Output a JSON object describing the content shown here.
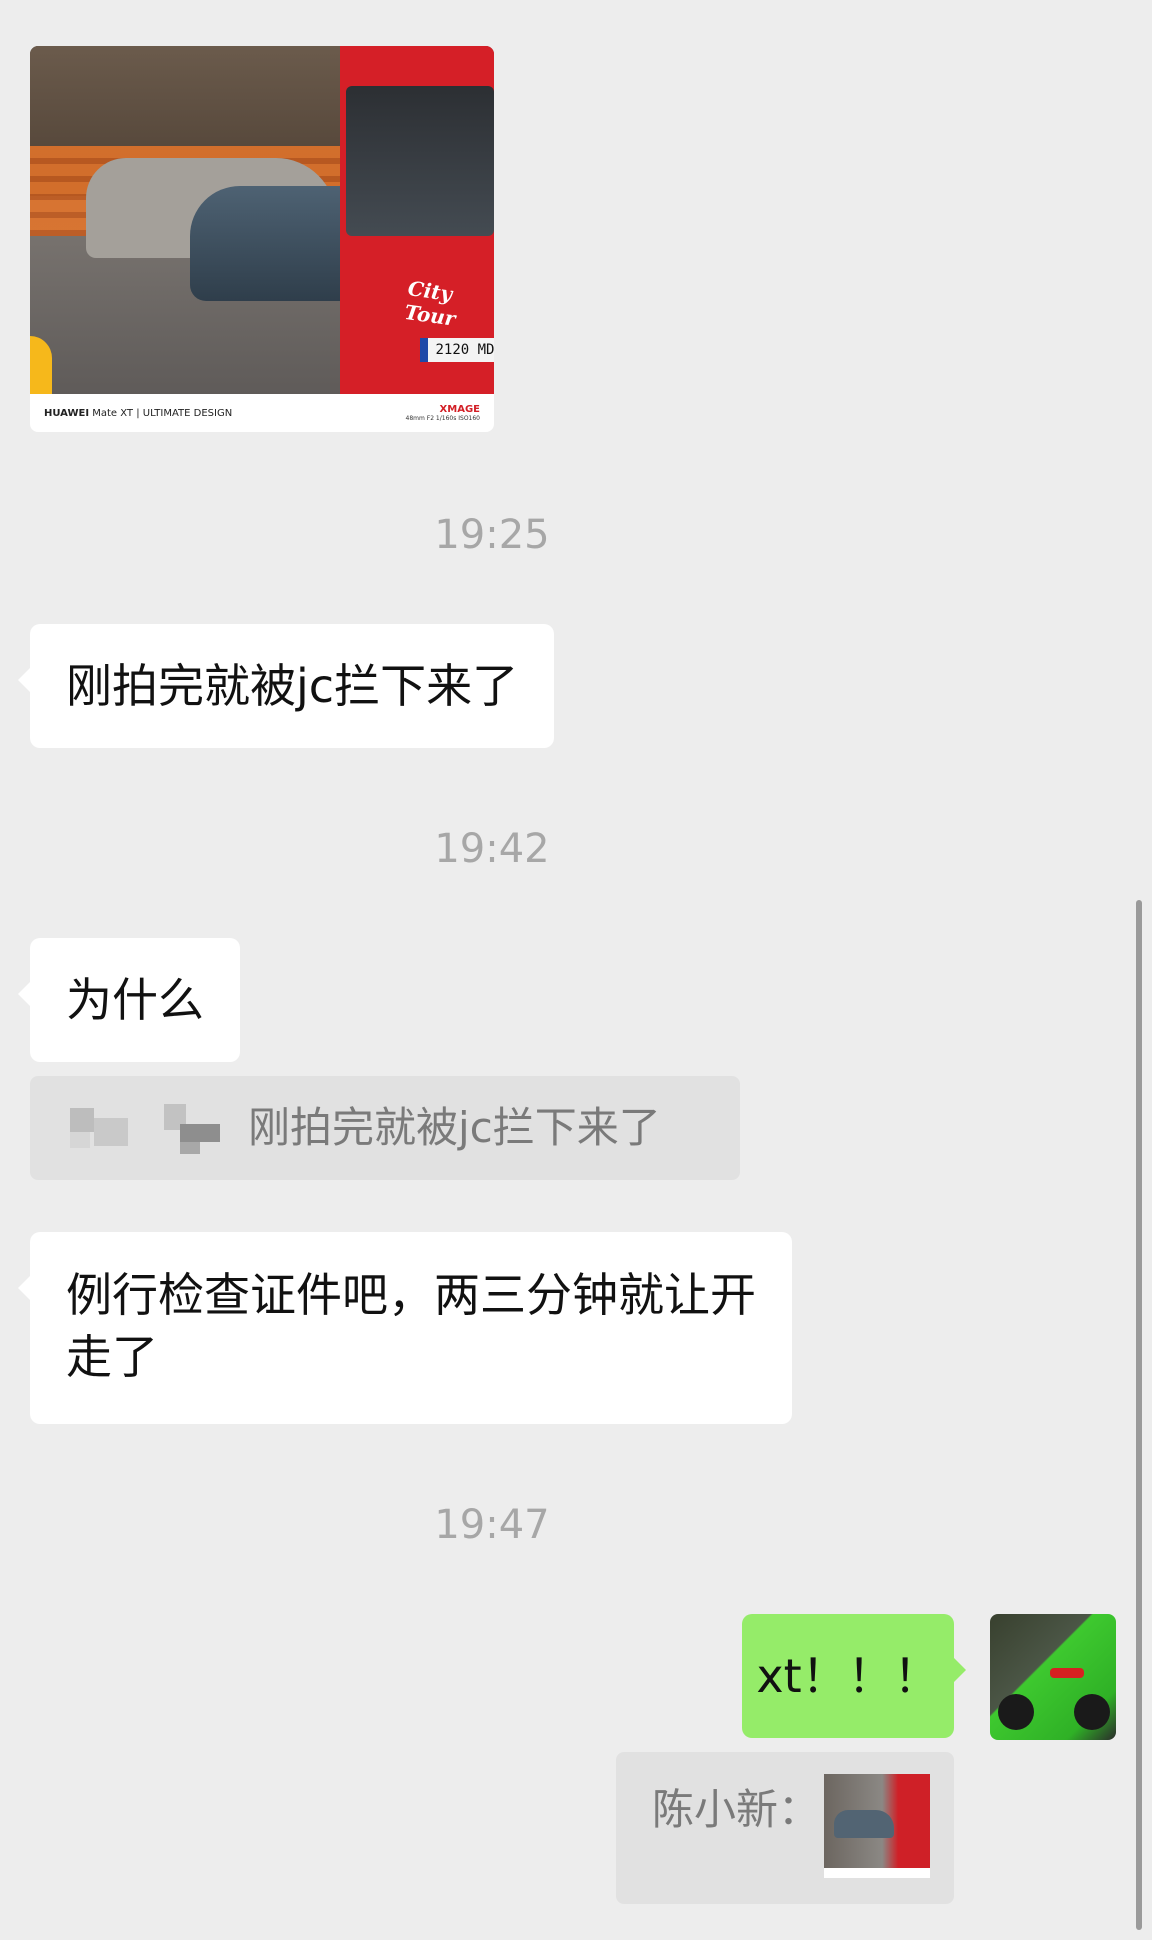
{
  "photo_message": {
    "watermark_brand": "HUAWEI",
    "watermark_model": "Mate XT | ULTIMATE DESIGN",
    "watermark_logo": "XMAGE",
    "watermark_specs": "48mm F2 1/160s ISO160",
    "bus_text": "City Tour",
    "plate_text": "2120 MD"
  },
  "timestamps": [
    "19:25",
    "19:42",
    "19:47"
  ],
  "messages": [
    {
      "side": "in",
      "text": "刚拍完就被jc拦下来了"
    },
    {
      "side": "in",
      "text": "为什么"
    },
    {
      "side": "in",
      "text": "例行检查证件吧，两三分钟就让开走了"
    },
    {
      "side": "out",
      "text": "xt！！！"
    }
  ],
  "quotes": [
    {
      "text": "刚拍完就被jc拦下来了"
    },
    {
      "sender": "陈小新："
    }
  ],
  "colors": {
    "background": "#ededed",
    "incoming_bubble": "#ffffff",
    "outgoing_bubble": "#95ec69",
    "quote_background": "#e1e1e1",
    "timestamp": "#a7a7a7"
  },
  "icons": {
    "avatar": "green-sports-car-avatar",
    "quote_blur": "blurred-username"
  }
}
